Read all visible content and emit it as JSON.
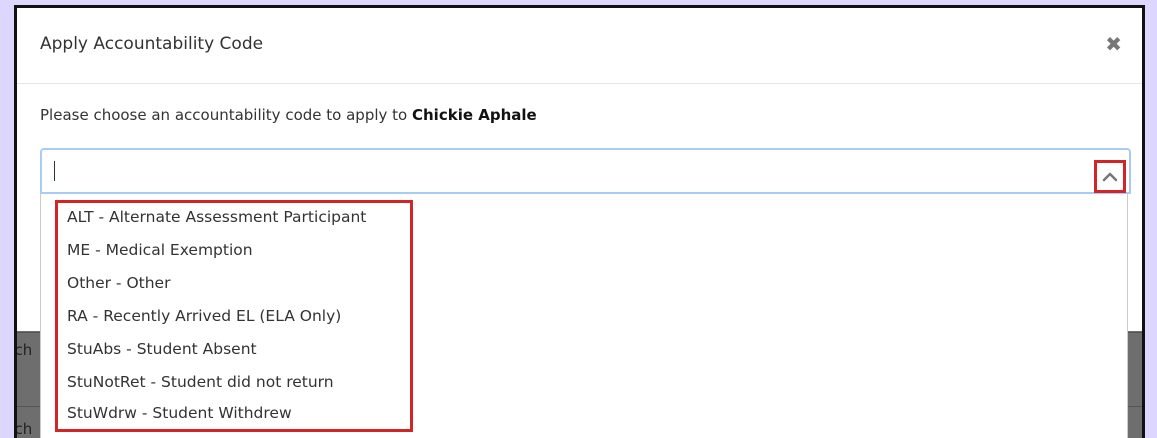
{
  "background": {
    "partial_rows": [
      "Sch",
      "Sch"
    ]
  },
  "modal": {
    "title": "Apply Accountability Code",
    "close_icon": "close-icon",
    "prompt_prefix": "Please choose an accountability code to apply to",
    "student_name": "Chickie Aphale"
  },
  "select": {
    "value": "",
    "toggle_icon": "chevron-up-icon",
    "options": [
      "ALT - Alternate Assessment Participant",
      "ME - Medical Exemption",
      "Other - Other",
      "RA - Recently Arrived EL (ELA Only)",
      "StuAbs - Student Absent",
      "StuNotRet - Student did not return",
      "StuWdrw - Student Withdrew"
    ]
  },
  "colors": {
    "page_background": "#ddd6ff",
    "highlight_border": "#d32525",
    "focus_border": "#a9ccf5",
    "backdrop": "#6e6e6e"
  }
}
